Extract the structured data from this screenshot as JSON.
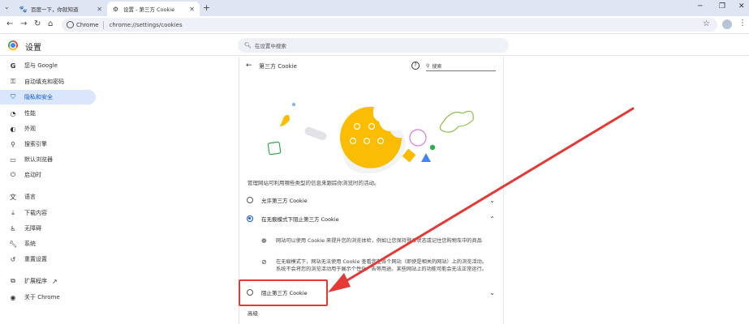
{
  "browser": {
    "tabs": [
      {
        "title": "百度一下，你就知道",
        "active": false,
        "favicon": "baidu-paw-icon"
      },
      {
        "title": "设置 - 第三方 Cookie",
        "active": true,
        "favicon": "gear-icon"
      }
    ],
    "new_tab_label": "+",
    "chip_label": "Chrome",
    "url": "chrome://settings/cookies"
  },
  "settings": {
    "title": "设置",
    "search_placeholder": "在设置中搜索"
  },
  "sidebar": {
    "items": [
      {
        "label": "您与 Google",
        "icon": "google-g-icon",
        "active": false
      },
      {
        "label": "自动填充和密码",
        "icon": "key-icon",
        "active": false
      },
      {
        "label": "隐私和安全",
        "icon": "shield-icon",
        "active": true
      },
      {
        "label": "性能",
        "icon": "speedometer-icon",
        "active": false
      },
      {
        "label": "外观",
        "icon": "palette-icon",
        "active": false
      },
      {
        "label": "搜索引擎",
        "icon": "search-icon",
        "active": false
      },
      {
        "label": "默认浏览器",
        "icon": "browser-window-icon",
        "active": false
      },
      {
        "label": "启动时",
        "icon": "power-icon",
        "active": false
      },
      {
        "label": "语言",
        "icon": "translate-icon",
        "active": false
      },
      {
        "label": "下载内容",
        "icon": "download-icon",
        "active": false
      },
      {
        "label": "无障碍",
        "icon": "accessibility-icon",
        "active": false
      },
      {
        "label": "系统",
        "icon": "wrench-icon",
        "active": false
      },
      {
        "label": "重置设置",
        "icon": "reset-icon",
        "active": false
      },
      {
        "label": "扩展程序",
        "icon": "puzzle-icon",
        "active": false
      },
      {
        "label": "关于 Chrome",
        "icon": "chrome-logo-icon",
        "active": false
      }
    ]
  },
  "page": {
    "title": "第三方 Cookie",
    "search_label": "搜索",
    "description": "管理网站可利用哪些类型的信息来跟踪你浏览时的活动。",
    "options": [
      {
        "label": "允许第三方 Cookie",
        "checked": false,
        "expanded": false
      },
      {
        "label": "在无痕模式下阻止第三方 Cookie",
        "checked": true,
        "expanded": true
      },
      {
        "label": "阻止第三方 Cookie",
        "checked": false,
        "expanded": false
      }
    ],
    "details": [
      {
        "icon": "cookie-icon",
        "text": "网站可以使用 Cookie 来提升您的浏览体验，例如让您保持登录状态或记住您购物车中的商品"
      },
      {
        "icon": "block-icon",
        "line1": "在无痕模式下，网站无法使用 Cookie 查看您在各个网站（即使是相关的网站）上的浏览活动。",
        "line2": "系统不会将您的浏览活动用于展示个性化广告等用途。某些网站上的功能可能会无法正常运行。"
      }
    ],
    "section_label": "高级"
  },
  "annotation": {
    "color": "#e53935"
  }
}
